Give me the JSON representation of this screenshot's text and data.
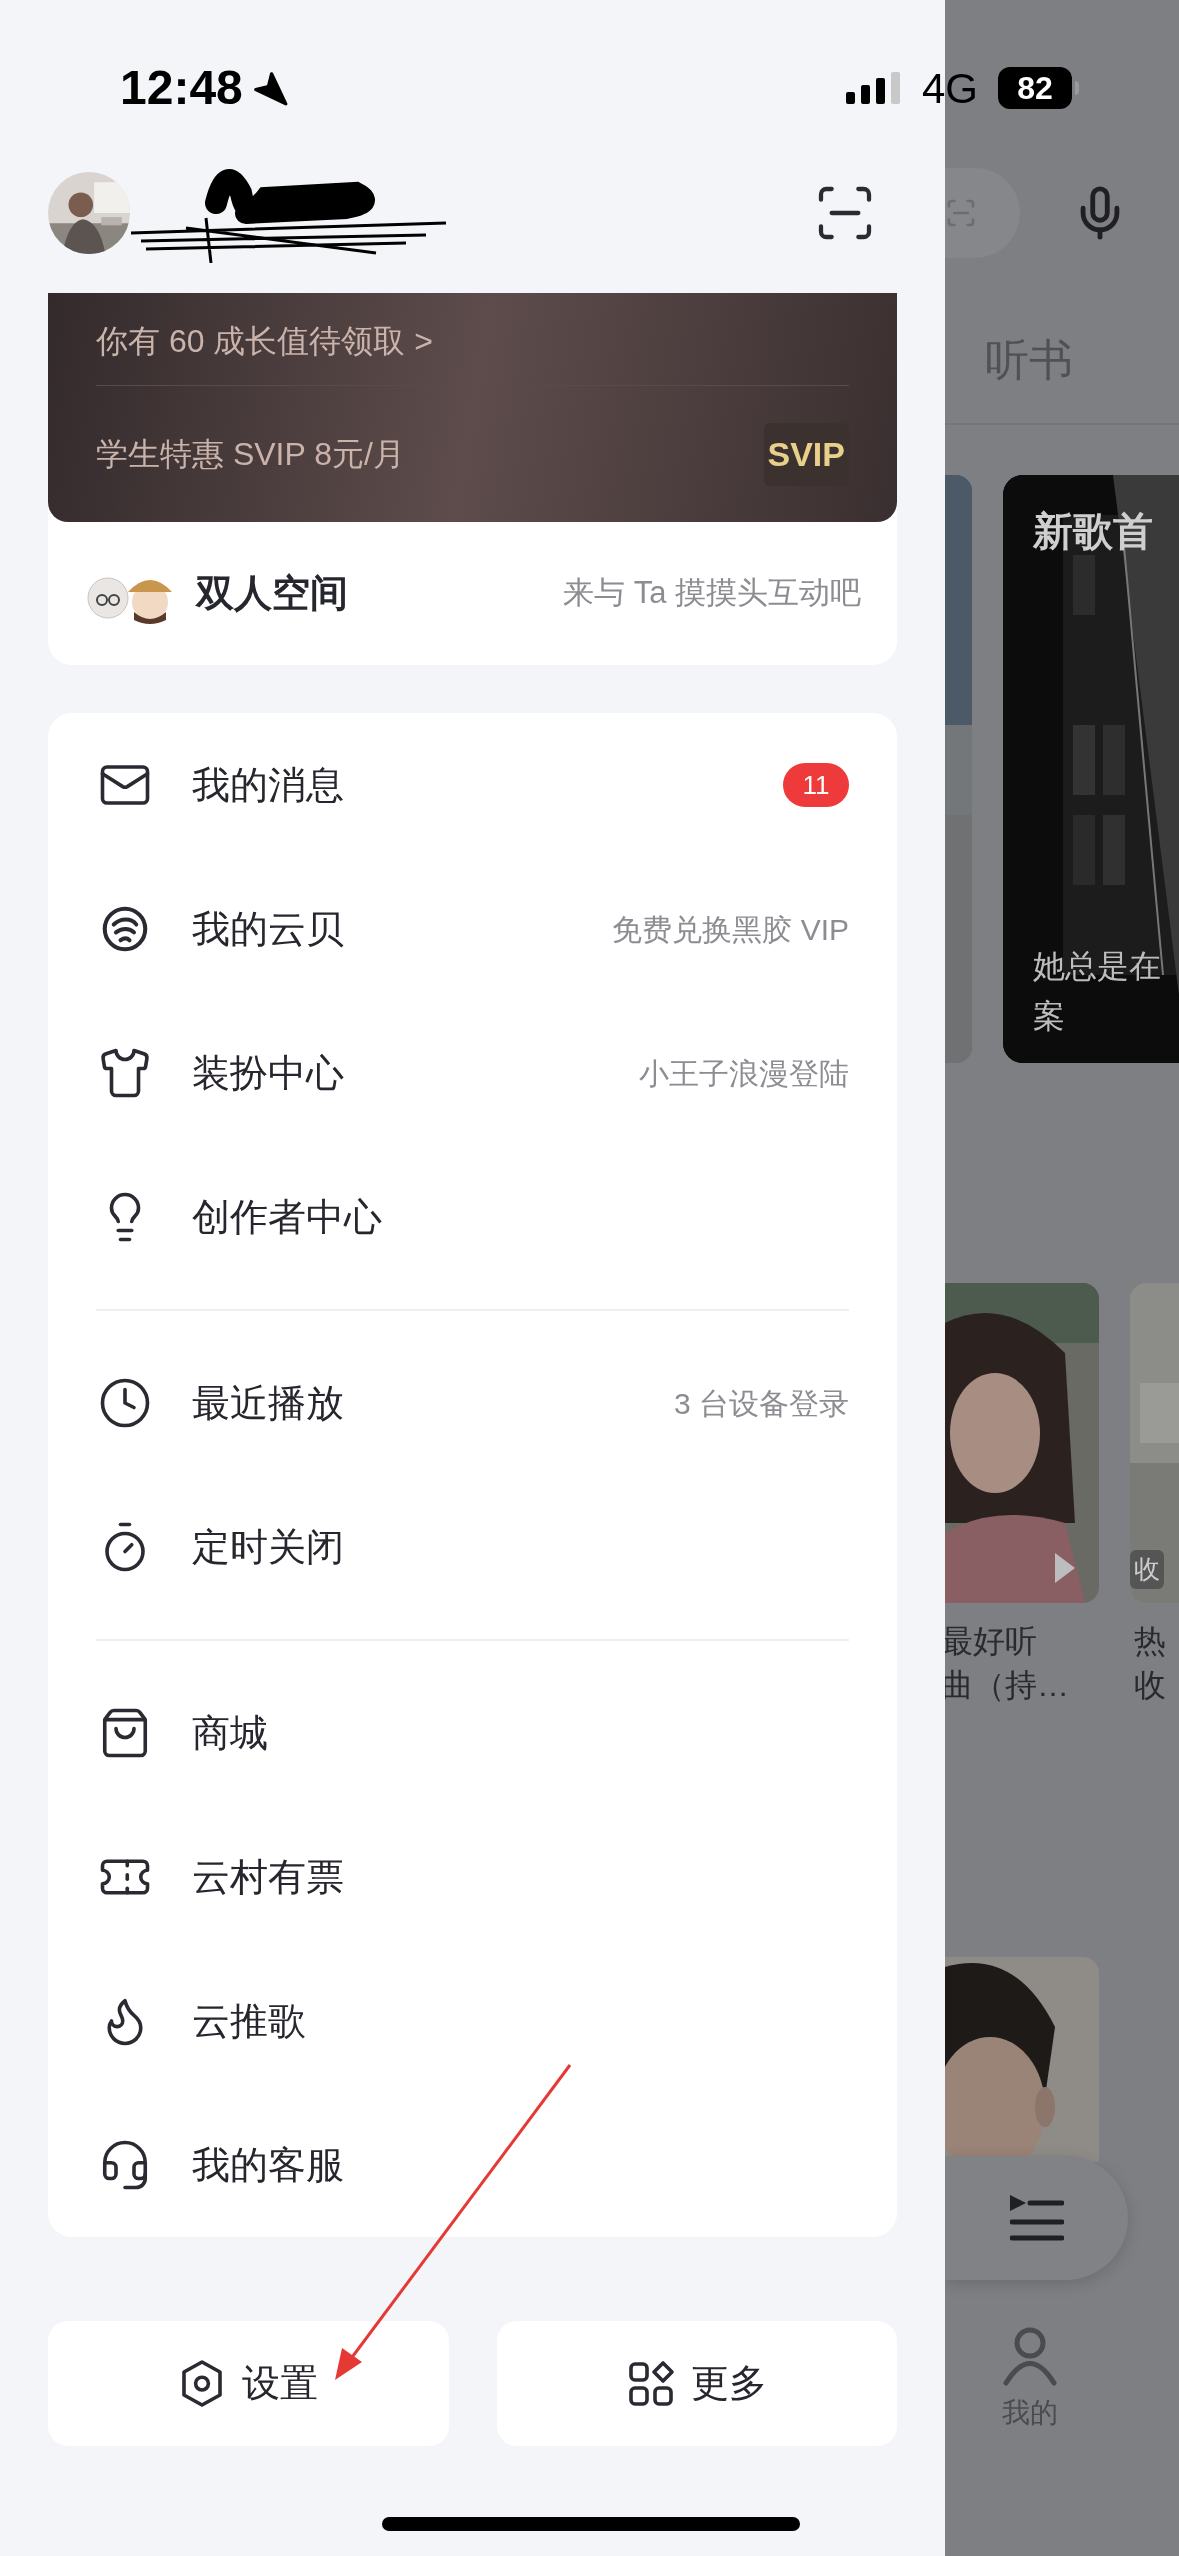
{
  "status_bar": {
    "time": "12:48",
    "network": "4G",
    "battery": "82"
  },
  "vip_card": {
    "growth_text": "你有 60 成长值待领取 >",
    "offer_text": "学生特惠 SVIP 8元/月",
    "badge": "SVIP"
  },
  "couple_space": {
    "title": "双人空间",
    "hint": "来与 Ta 摸摸头互动吧"
  },
  "menu_groups": [
    {
      "items": [
        {
          "label": "我的消息",
          "badge": "11"
        },
        {
          "label": "我的云贝",
          "detail": "免费兑换黑胶 VIP"
        },
        {
          "label": "装扮中心",
          "detail": "小王子浪漫登陆"
        },
        {
          "label": "创作者中心"
        }
      ]
    },
    {
      "items": [
        {
          "label": "最近播放",
          "detail": "3 台设备登录"
        },
        {
          "label": "定时关闭"
        }
      ]
    },
    {
      "items": [
        {
          "label": "商城"
        },
        {
          "label": "云村有票"
        },
        {
          "label": "云推歌"
        },
        {
          "label": "我的客服"
        }
      ]
    }
  ],
  "bottom_buttons": [
    {
      "label": "设置"
    },
    {
      "label": "更多"
    }
  ],
  "background_page": {
    "tab": "听书",
    "featured_card": {
      "title": "新歌首",
      "caption_lines": [
        "她总是在",
        "案"
      ]
    },
    "playlist_cards": [
      {
        "title_lines": [
          "最好听",
          "曲（持…"
        ]
      },
      {
        "badge": "收",
        "title_lines": [
          "热",
          "收"
        ]
      }
    ],
    "nav_tab": "我的"
  }
}
